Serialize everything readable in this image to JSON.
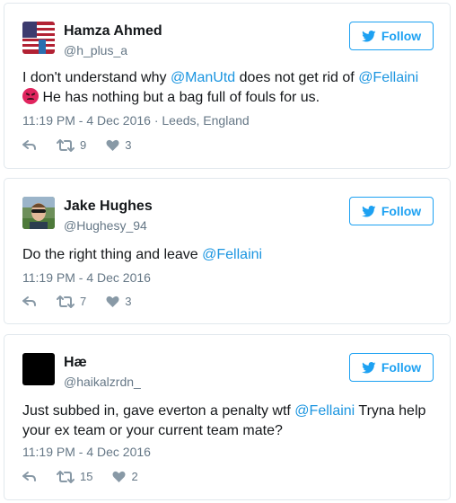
{
  "follow_label": "Follow",
  "colors": {
    "accent": "#1da1f2",
    "mention": "#1b95e0",
    "muted": "#657786",
    "border": "#e1e8ed"
  },
  "tweets": [
    {
      "name": "Hamza Ahmed",
      "handle": "@h_plus_a",
      "text_parts": [
        "I don't understand why ",
        "@ManUtd",
        " does not get rid of ",
        "@Fellaini",
        "He has nothing but a bag full of fouls for us."
      ],
      "emoji": "angry-face-icon",
      "meta": "11:19 PM - 4 Dec 2016 · Leeds, England",
      "retweets": "9",
      "likes": "3"
    },
    {
      "name": "Jake Hughes",
      "handle": "@Hughesy_94",
      "text_parts": [
        "Do the right thing and leave ",
        "@Fellaini"
      ],
      "meta": "11:19 PM - 4 Dec 2016",
      "retweets": "7",
      "likes": "3"
    },
    {
      "name": "Hæ",
      "handle": "@haikalzrdn_",
      "text_parts": [
        "Just subbed in, gave everton a penalty wtf ",
        "@Fellaini",
        " Tryna help your ex team or your current team mate?"
      ],
      "meta": "11:19 PM - 4 Dec 2016",
      "retweets": "15",
      "likes": "2"
    }
  ]
}
